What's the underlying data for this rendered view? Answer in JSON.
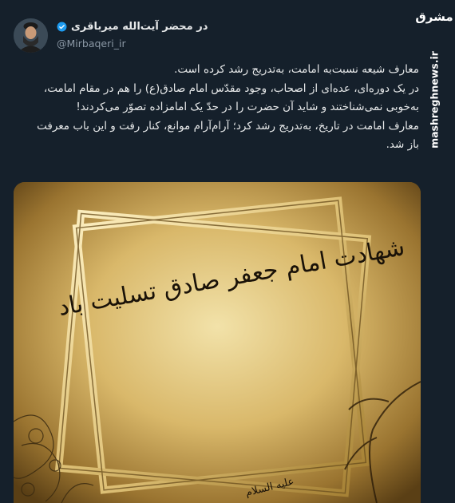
{
  "header": {
    "display_name": "در محضر آیت‌الله میرباقری",
    "handle": "@Mirbaqeri_ir",
    "verified_icon": "verified-badge-icon",
    "accent_color": "#1d9bf0"
  },
  "tweet": {
    "lines": [
      "معارف شیعه نسبت‌به امامت، به‌تدریج رشد کرده است.",
      "در یک دوره‌ای، عده‌ای از اصحاب، وجود مقدّس امام صادق(ع) را هم در مقام امامت، به‌خوبی نمی‌شناختند و شاید آن حضرت را در حدّ یک امامزاده تصوّر می‌کردند!",
      "معارف امامت در تاریخ، به‌تدریج رشد کرد؛ آرام‌آرام موانع، کنار رفت و این باب معرفت باز شد."
    ]
  },
  "media": {
    "calligraphy_main": "شهادت امام جعفر صادق تسلیت باد",
    "calligraphy_small": "علیه السلام"
  },
  "watermark": {
    "logo": "مشرق",
    "site": "mashreghnews.ir"
  }
}
